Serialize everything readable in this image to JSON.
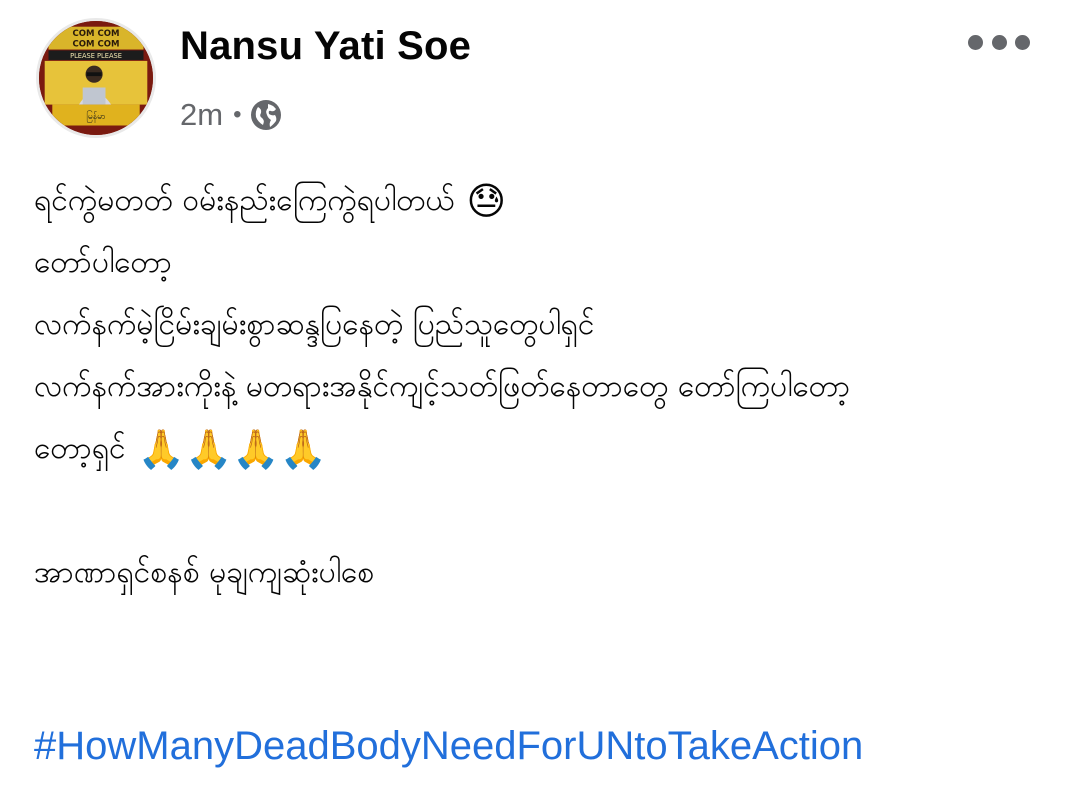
{
  "post": {
    "author": "Nansu Yati Soe",
    "time": "2m",
    "separator": "•",
    "privacy_icon": "globe-icon",
    "more_icon": "more-horizontal-icon",
    "lines": [
      {
        "text": "ရင်ကွဲမတတ် ဝမ်းနည်းကြေကွဲရပါတယ်",
        "emoji": "😓"
      },
      {
        "text": "တော်ပါတော့",
        "emoji": ""
      },
      {
        "text": "လက်နက်မဲ့ငြိမ်းချမ်းစွာဆန္ဒပြနေတဲ့ ပြည်သူတွေပါရှင်",
        "emoji": ""
      },
      {
        "text": "လက်နက်အားကိုးနဲ့ မတရားအနိုင်ကျင့်သတ်ဖြတ်နေတာတွေ တော်ကြပါတော့",
        "emoji": ""
      },
      {
        "text": "တော့ရှင်",
        "emoji": "🙏🙏🙏🙏"
      },
      {
        "text": "အာဏာရှင်စနစ် မုချကျဆုံးပါစေ",
        "emoji": ""
      }
    ],
    "hashtag": "#HowManyDeadBodyNeedForUNtoTakeAction",
    "colors": {
      "name": "#050505",
      "meta": "#65676b",
      "hashtag": "#216fdb",
      "background": "#ffffff"
    },
    "avatar": {
      "sign_top": "COM COM",
      "sign_mid": "PLEASE PLEASE",
      "caption": "မြန်မာ"
    }
  }
}
